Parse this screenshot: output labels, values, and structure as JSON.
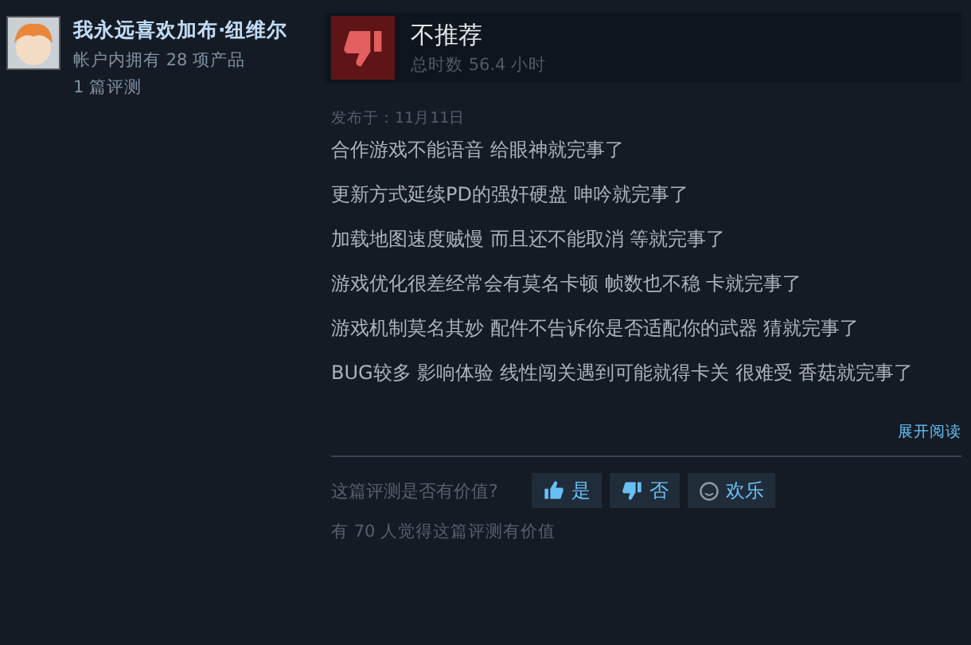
{
  "author": {
    "name": "我永远喜欢加布·纽维尔",
    "products": "帐户内拥有 28 项产品",
    "reviews": "1 篇评测"
  },
  "review": {
    "recommended": false,
    "verdict": "不推荐",
    "hours": "总时数 56.4 小时",
    "posted": "发布于：11月11日",
    "paragraphs": [
      "合作游戏不能语音 给眼神就完事了",
      "更新方式延续PD的强奸硬盘 呻吟就完事了",
      "加载地图速度贼慢 而且还不能取消 等就完事了",
      "游戏优化很差经常会有莫名卡顿 帧数也不稳 卡就完事了",
      "游戏机制莫名其妙 配件不告诉你是否适配你的武器 猜就完事了",
      "BUG较多 影响体验 线性闯关遇到可能就得卡关 很难受 香菇就完事了"
    ],
    "expand": "展开阅读"
  },
  "helpful": {
    "question": "这篇评测是否有价值?",
    "buttons": [
      {
        "kind": "yes",
        "label": "是"
      },
      {
        "kind": "no",
        "label": "否"
      },
      {
        "kind": "funny",
        "label": "欢乐"
      }
    ],
    "count": "有 70 人觉得这篇评测有价值"
  }
}
